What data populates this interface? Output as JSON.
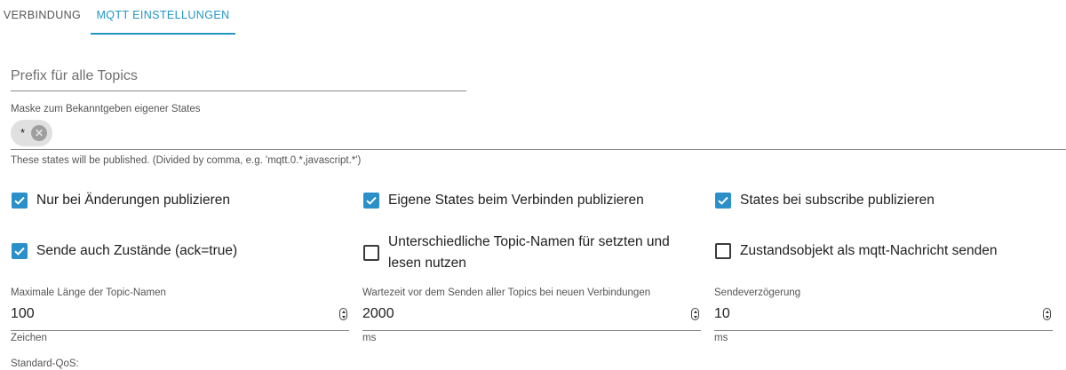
{
  "tabs": [
    {
      "label": "VERBINDUNG",
      "active": false
    },
    {
      "label": "MQTT EINSTELLUNGEN",
      "active": true
    }
  ],
  "colors": {
    "accent": "#2196c4",
    "checkbox_checked": "#2b8fc9"
  },
  "prefix": {
    "placeholder": "Prefix für alle Topics",
    "value": ""
  },
  "mask": {
    "label": "Maske zum Bekanntgeben eigener States",
    "chips": [
      {
        "label": "*",
        "delete_icon": "cancel-circle-icon"
      }
    ],
    "helper": "These states will be published. (Divided by comma, e.g. 'mqtt.0.*,javascript.*')"
  },
  "checkboxes": [
    {
      "label": "Nur bei Änderungen publizieren",
      "checked": true
    },
    {
      "label": "Eigene States beim Verbinden publizieren",
      "checked": true
    },
    {
      "label": "States bei subscribe publizieren",
      "checked": true
    },
    {
      "label": "Sende auch Zustände (ack=true)",
      "checked": true
    },
    {
      "label_line1": "Unterschiedliche Topic-Namen für setzten und",
      "label_line2": "lesen nutzen",
      "checked": false
    },
    {
      "label": "Zustandsobjekt als mqtt-Nachricht senden",
      "checked": false
    }
  ],
  "number_fields": [
    {
      "label": "Maximale Länge der Topic-Namen",
      "value": "100",
      "helper": "Zeichen"
    },
    {
      "label": "Wartezeit vor dem Senden aller Topics bei neuen Verbindungen",
      "value": "2000",
      "helper": "ms"
    },
    {
      "label": "Sendeverzögerung",
      "value": "10",
      "helper": "ms"
    }
  ],
  "qos": {
    "label": "Standard-QoS:"
  }
}
